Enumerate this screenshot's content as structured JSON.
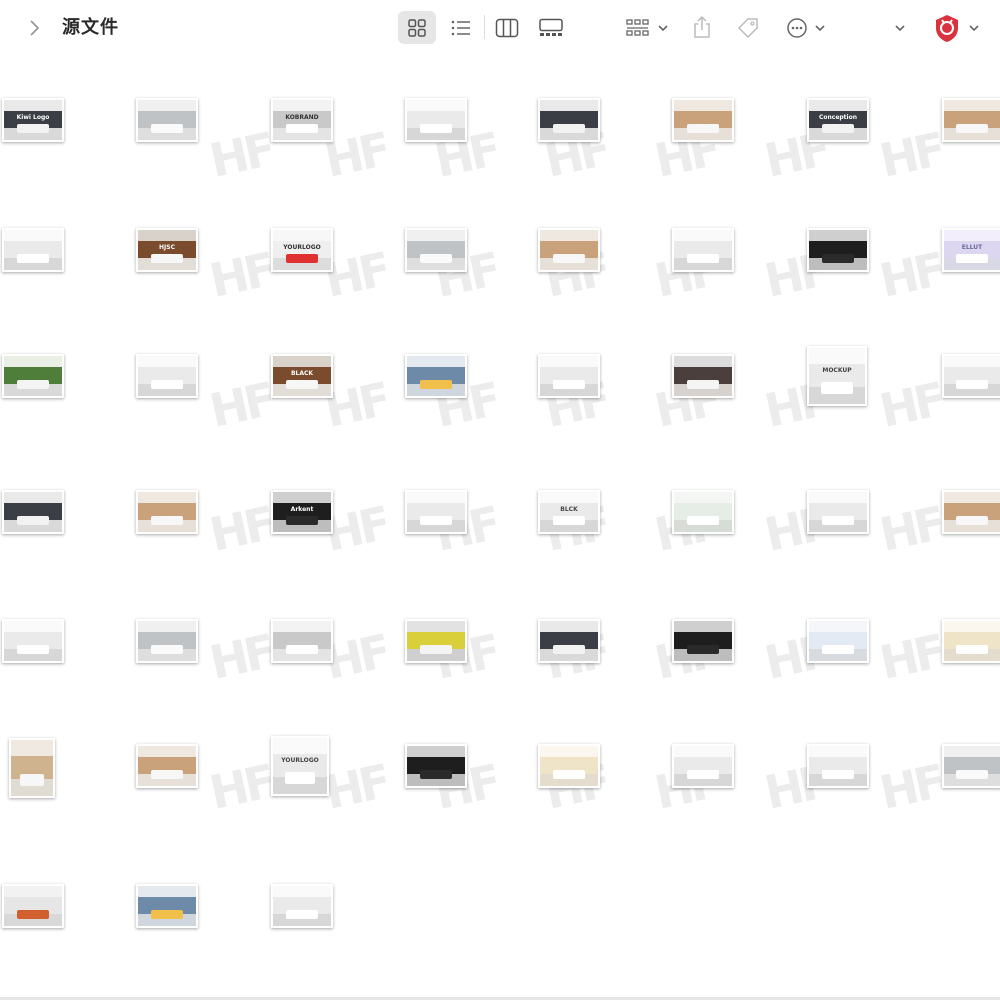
{
  "window": {
    "title": "源文件"
  },
  "toolbar": {
    "back_icon": "chevron-right-icon",
    "view_icons": [
      "grid-view-icon",
      "list-view-icon",
      "column-view-icon",
      "gallery-view-icon"
    ],
    "group_icon": "group-grid-icon",
    "share_icon": "share-icon",
    "tag_icon": "tag-icon",
    "more_icon": "ellipsis-circle-icon",
    "expand_icon": "chevron-down-icon",
    "extension_icon": "shield-extension-icon",
    "accent_color": "#d9333f"
  },
  "watermark": {
    "text": "HF"
  },
  "files": [
    {
      "logo": "Kiwi Logo",
      "tone": "dark"
    },
    {
      "logo": "",
      "tone": "gray"
    },
    {
      "logo": "KOBRAND",
      "tone": "silver"
    },
    {
      "logo": "",
      "tone": "white"
    },
    {
      "logo": "",
      "tone": "dark"
    },
    {
      "logo": "",
      "tone": "wood"
    },
    {
      "logo": "Conception",
      "tone": "dark"
    },
    {
      "logo": "",
      "tone": "wood"
    },
    {
      "logo": "",
      "tone": "white"
    },
    {
      "logo": "HJSC",
      "tone": "wood-dark"
    },
    {
      "logo": "YOURLOGO",
      "tone": "white-red"
    },
    {
      "logo": "",
      "tone": "gray"
    },
    {
      "logo": "",
      "tone": "wood"
    },
    {
      "logo": "",
      "tone": "white"
    },
    {
      "logo": "",
      "tone": "black"
    },
    {
      "logo": "ELLUT",
      "tone": "purple"
    },
    {
      "logo": "",
      "tone": "green"
    },
    {
      "logo": "",
      "tone": "white"
    },
    {
      "logo": "BLACK",
      "tone": "wood-dark"
    },
    {
      "logo": "",
      "tone": "blue"
    },
    {
      "logo": "",
      "tone": "white"
    },
    {
      "logo": "",
      "tone": "dark-red"
    },
    {
      "logo": "MOCKUP",
      "tone": "white"
    },
    {
      "logo": "",
      "tone": "white"
    },
    {
      "logo": "",
      "tone": "dark"
    },
    {
      "logo": "",
      "tone": "wood"
    },
    {
      "logo": "Arkent",
      "tone": "black"
    },
    {
      "logo": "",
      "tone": "white"
    },
    {
      "logo": "BLCK",
      "tone": "white"
    },
    {
      "logo": "",
      "tone": "green-white"
    },
    {
      "logo": "",
      "tone": "white"
    },
    {
      "logo": "",
      "tone": "wood"
    },
    {
      "logo": "",
      "tone": "white"
    },
    {
      "logo": "",
      "tone": "gray"
    },
    {
      "logo": "",
      "tone": "silver"
    },
    {
      "logo": "",
      "tone": "yellow"
    },
    {
      "logo": "",
      "tone": "dark"
    },
    {
      "logo": "",
      "tone": "black"
    },
    {
      "logo": "",
      "tone": "blue-white"
    },
    {
      "logo": "",
      "tone": "cream"
    },
    {
      "logo": "",
      "tone": "portrait"
    },
    {
      "logo": "",
      "tone": "wood"
    },
    {
      "logo": "YOURLOGO",
      "tone": "white"
    },
    {
      "logo": "",
      "tone": "black"
    },
    {
      "logo": "",
      "tone": "cream"
    },
    {
      "logo": "",
      "tone": "white"
    },
    {
      "logo": "",
      "tone": "white"
    },
    {
      "logo": "",
      "tone": "gray"
    },
    {
      "logo": "",
      "tone": "orange"
    },
    {
      "logo": "",
      "tone": "blue"
    },
    {
      "logo": "",
      "tone": "white"
    }
  ]
}
